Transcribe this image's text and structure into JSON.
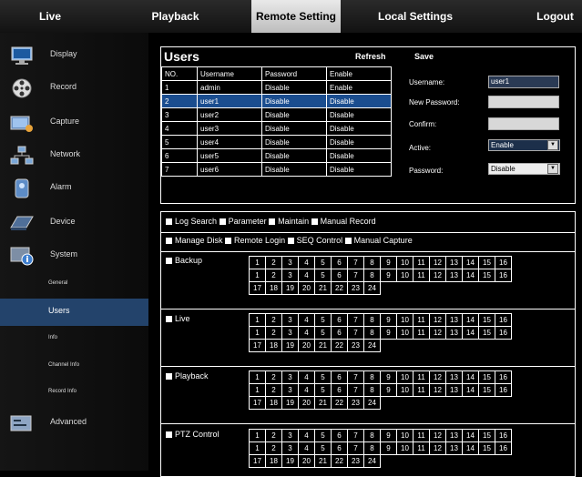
{
  "topnav": [
    {
      "label": "Live",
      "active": false
    },
    {
      "label": "Playback",
      "active": false
    },
    {
      "label": "Remote Setting",
      "active": true
    },
    {
      "label": "Local Settings",
      "active": false
    },
    {
      "label": "Logout",
      "active": false
    }
  ],
  "sidebar": {
    "items": [
      {
        "label": "Display",
        "icon": "monitor-icon"
      },
      {
        "label": "Record",
        "icon": "film-reel-icon"
      },
      {
        "label": "Capture",
        "icon": "camera-icon"
      },
      {
        "label": "Network",
        "icon": "network-icon"
      },
      {
        "label": "Alarm",
        "icon": "alarm-icon"
      },
      {
        "label": "Device",
        "icon": "disk-icon"
      },
      {
        "label": "System",
        "icon": "system-info-icon"
      }
    ],
    "sub_items": [
      {
        "label": "General",
        "active": false
      },
      {
        "label": "Users",
        "active": true
      },
      {
        "label": "Info",
        "active": false
      },
      {
        "label": "Channel Info",
        "active": false
      },
      {
        "label": "Record Info",
        "active": false
      }
    ],
    "advanced": {
      "label": "Advanced",
      "icon": "advanced-icon"
    }
  },
  "users_panel": {
    "title": "Users",
    "refresh": "Refresh",
    "save": "Save",
    "columns": [
      "NO.",
      "Username",
      "Password",
      "Enable"
    ],
    "rows": [
      [
        "1",
        "admin",
        "Disable",
        "Enable"
      ],
      [
        "2",
        "user1",
        "Disable",
        "Disable"
      ],
      [
        "3",
        "user2",
        "Disable",
        "Disable"
      ],
      [
        "4",
        "user3",
        "Disable",
        "Disable"
      ],
      [
        "5",
        "user4",
        "Disable",
        "Disable"
      ],
      [
        "6",
        "user5",
        "Disable",
        "Disable"
      ],
      [
        "7",
        "user6",
        "Disable",
        "Disable"
      ]
    ],
    "selected_row": 1,
    "form": {
      "username_label": "Username:",
      "username_value": "user1",
      "new_password_label": "New Password:",
      "confirm_label": "Confirm:",
      "active_label": "Active:",
      "active_value": "Enable",
      "password_label": "Password:",
      "password_value": "Disable"
    }
  },
  "permissions": {
    "row1": [
      "Log Search",
      "Parameter",
      "Maintain",
      "Manual Record"
    ],
    "row2": [
      "Manage Disk",
      "Remote Login",
      "SEQ Control",
      "Manual Capture"
    ],
    "groups": [
      "Backup",
      "Live",
      "Playback",
      "PTZ Control"
    ],
    "channels_row1": [
      "1",
      "2",
      "3",
      "4",
      "5",
      "6",
      "7",
      "8",
      "9",
      "10",
      "11",
      "12",
      "13",
      "14",
      "15",
      "16"
    ],
    "channels_row2": [
      "1",
      "2",
      "3",
      "4",
      "5",
      "6",
      "7",
      "8",
      "9",
      "10",
      "11",
      "12",
      "13",
      "14",
      "15",
      "16"
    ],
    "channels_row3": [
      "17",
      "18",
      "19",
      "20",
      "21",
      "22",
      "23",
      "24"
    ]
  },
  "colors": {
    "accent": "#23436b",
    "selected_row": "#1a4d8f"
  }
}
